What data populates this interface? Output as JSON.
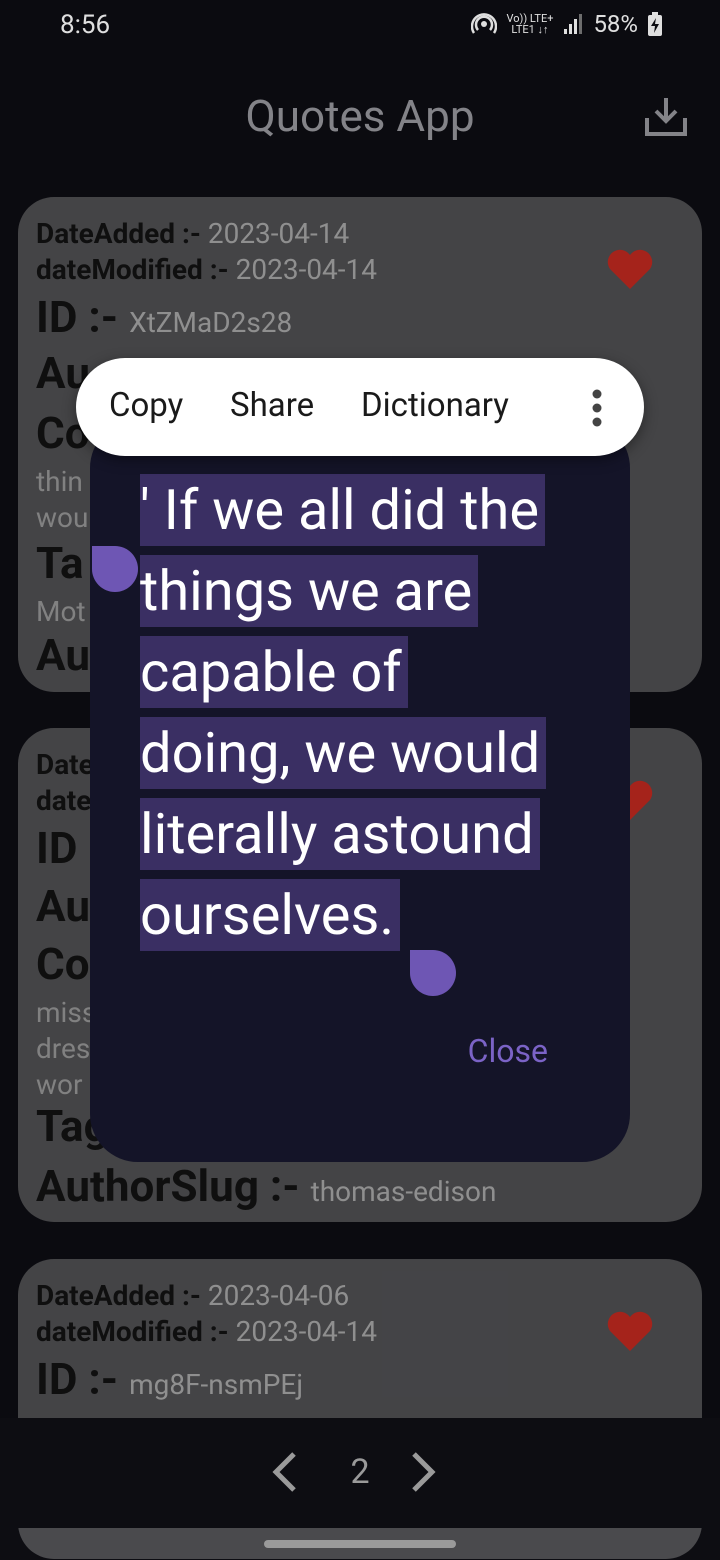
{
  "status": {
    "time": "8:56",
    "network_top": "Vo)) LTE+",
    "network_bottom": "LTE1 ↓↑",
    "battery": "58%"
  },
  "app_bar": {
    "title": "Quotes App",
    "download_icon": "download-icon"
  },
  "cards": [
    {
      "date_added_label": "DateAdded :-",
      "date_added": "2023-04-14",
      "date_modified_label": "dateModified :-",
      "date_modified": "2023-04-14",
      "id_label": "ID :-",
      "id": "XtZMaD2s28",
      "author_partial": "Au",
      "content_partial": "Co",
      "text_line1": "thin",
      "text_line2": "wou",
      "tags_partial": "Ta",
      "tag_value_partial": "Mot",
      "author_slug_partial": "Au"
    },
    {
      "date_added_partial": "Date",
      "date_modified_partial": "date",
      "id_label": "ID",
      "author_partial": "Au",
      "content_partial": "Co",
      "text_line1": "miss",
      "text_line2": "dres",
      "text_line3": "wor",
      "tags_partial": "Tag",
      "author_slug_label": "AuthorSlug :-",
      "author_slug": "thomas-edison"
    },
    {
      "date_added_label": "DateAdded :-",
      "date_added": "2023-04-06",
      "date_modified_label": "dateModified :-",
      "date_modified": "2023-04-14",
      "id_label": "ID :-",
      "id": "mg8F-nsmPEj"
    }
  ],
  "dialog": {
    "quote_lines": [
      "' If we all did the",
      "things we are",
      "capable of",
      "doing, we would",
      "literally astound",
      "ourselves."
    ],
    "close_label": "Close"
  },
  "text_toolbar": {
    "copy": "Copy",
    "share": "Share",
    "dictionary": "Dictionary"
  },
  "pager": {
    "page": "2"
  },
  "colors": {
    "accent": "#7b63c6",
    "selection": "#3a2f63",
    "heart": "#b3261e"
  }
}
